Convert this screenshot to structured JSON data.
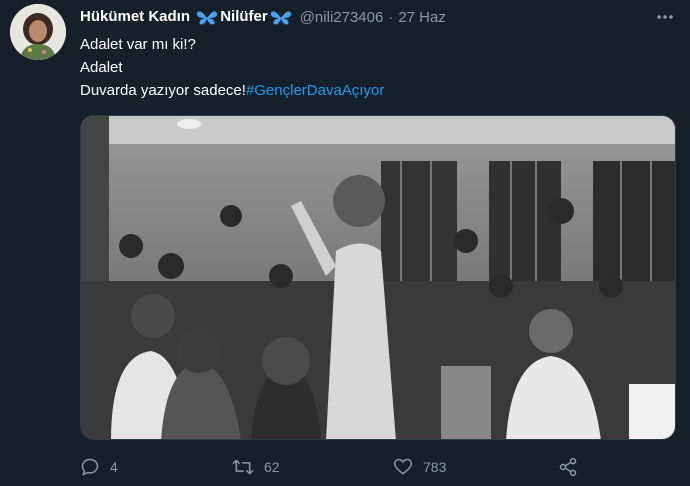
{
  "tweet": {
    "author": {
      "display_name_pre": "Hükümet Kadın",
      "display_name_post": "Nilüfer",
      "handle": "@nili273406",
      "avatar_icon": "avatar-photo"
    },
    "separator": "·",
    "date": "27 Haz",
    "lines": [
      "Adalet var mı ki!?",
      "Adalet"
    ],
    "last_line_text": "Duvarda yazıyor sadece!",
    "hashtag": "#GençlerDavaAçıyor",
    "media": {
      "description_icon": "courtroom-photo"
    },
    "actions": {
      "replies": "4",
      "retweets": "62",
      "likes": "783"
    },
    "colors": {
      "background": "#15202b",
      "text": "#ffffff",
      "secondary": "#8b98a5",
      "accent": "#1d9bf0",
      "butterfly": "#4aa3f0"
    }
  }
}
